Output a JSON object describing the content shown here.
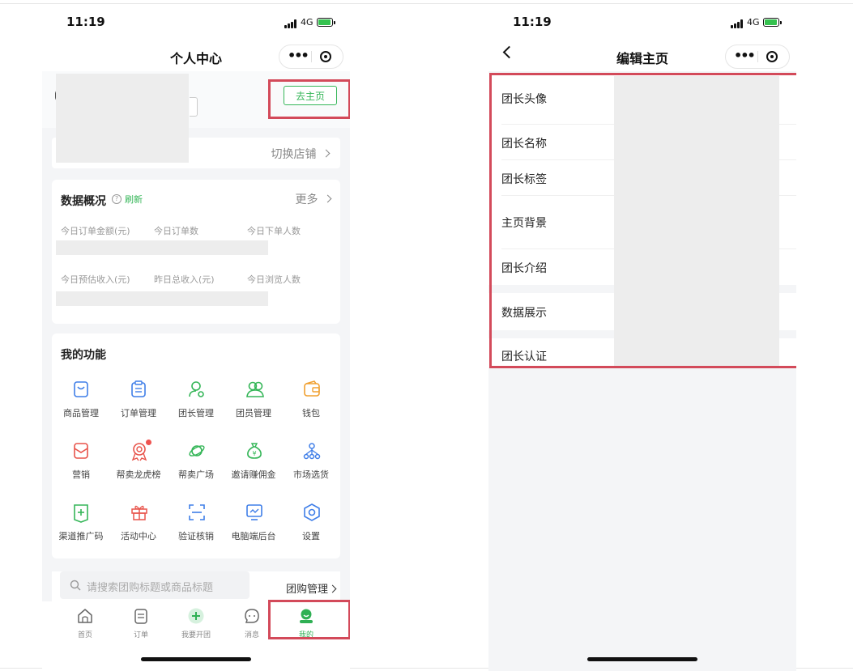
{
  "status_bar": {
    "time": "11:19",
    "network": "4G"
  },
  "left_screen": {
    "nav_title": "个人中心",
    "go_home_button": "去主页",
    "switch_shop": "切换店铺",
    "data_overview": {
      "title": "数据概况",
      "help_icon": "?",
      "refresh": "刷新",
      "more": "更多",
      "metrics_row1": [
        "今日订单金额(元)",
        "今日订单数",
        "今日下单人数"
      ],
      "metrics_row2": [
        "今日预估收入(元)",
        "昨日总收入(元)",
        "今日浏览人数"
      ]
    },
    "my_functions": {
      "title": "我的功能",
      "items": [
        {
          "label": "商品管理",
          "icon": "bag-icon",
          "color": "#3f7ee8"
        },
        {
          "label": "订单管理",
          "icon": "clipboard-icon",
          "color": "#3f7ee8"
        },
        {
          "label": "团长管理",
          "icon": "user-icon",
          "color": "#35b658"
        },
        {
          "label": "团员管理",
          "icon": "users-icon",
          "color": "#35b658"
        },
        {
          "label": "钱包",
          "icon": "wallet-icon",
          "color": "#f0a030"
        },
        {
          "label": "营销",
          "icon": "coupon-icon",
          "color": "#e8534a"
        },
        {
          "label": "帮卖龙虎榜",
          "icon": "medal-icon",
          "color": "#e8534a"
        },
        {
          "label": "帮卖广场",
          "icon": "planet-icon",
          "color": "#35b658"
        },
        {
          "label": "邀请赚佣金",
          "icon": "money-bag-icon",
          "color": "#35b658"
        },
        {
          "label": "市场选货",
          "icon": "network-icon",
          "color": "#3f7ee8"
        },
        {
          "label": "渠道推广码",
          "icon": "plus-tag-icon",
          "color": "#35b658"
        },
        {
          "label": "活动中心",
          "icon": "gift-icon",
          "color": "#e8534a"
        },
        {
          "label": "验证核销",
          "icon": "scan-icon",
          "color": "#3f7ee8"
        },
        {
          "label": "电脑端后台",
          "icon": "monitor-icon",
          "color": "#3f7ee8"
        },
        {
          "label": "设置",
          "icon": "settings-icon",
          "color": "#3f7ee8"
        }
      ]
    },
    "search": {
      "placeholder": "请搜索团购标题或商品标题",
      "group_mgmt": "团购管理"
    },
    "tabs": [
      {
        "label": "首页",
        "icon": "home-icon"
      },
      {
        "label": "订单",
        "icon": "order-icon"
      },
      {
        "label": "我要开团",
        "icon": "plus-circle-icon"
      },
      {
        "label": "消息",
        "icon": "message-icon"
      },
      {
        "label": "我的",
        "icon": "profile-icon",
        "active": true
      }
    ]
  },
  "right_screen": {
    "nav_title": "编辑主页",
    "rows": [
      {
        "label": "团长头像"
      },
      {
        "label": "团长名称"
      },
      {
        "label": "团长标签"
      },
      {
        "label": "主页背景"
      },
      {
        "label": "团长介绍"
      },
      {
        "label": "数据展示"
      },
      {
        "label": "团长认证"
      }
    ]
  },
  "colors": {
    "accent_green": "#35b658",
    "highlight_red": "#d34a5a"
  }
}
